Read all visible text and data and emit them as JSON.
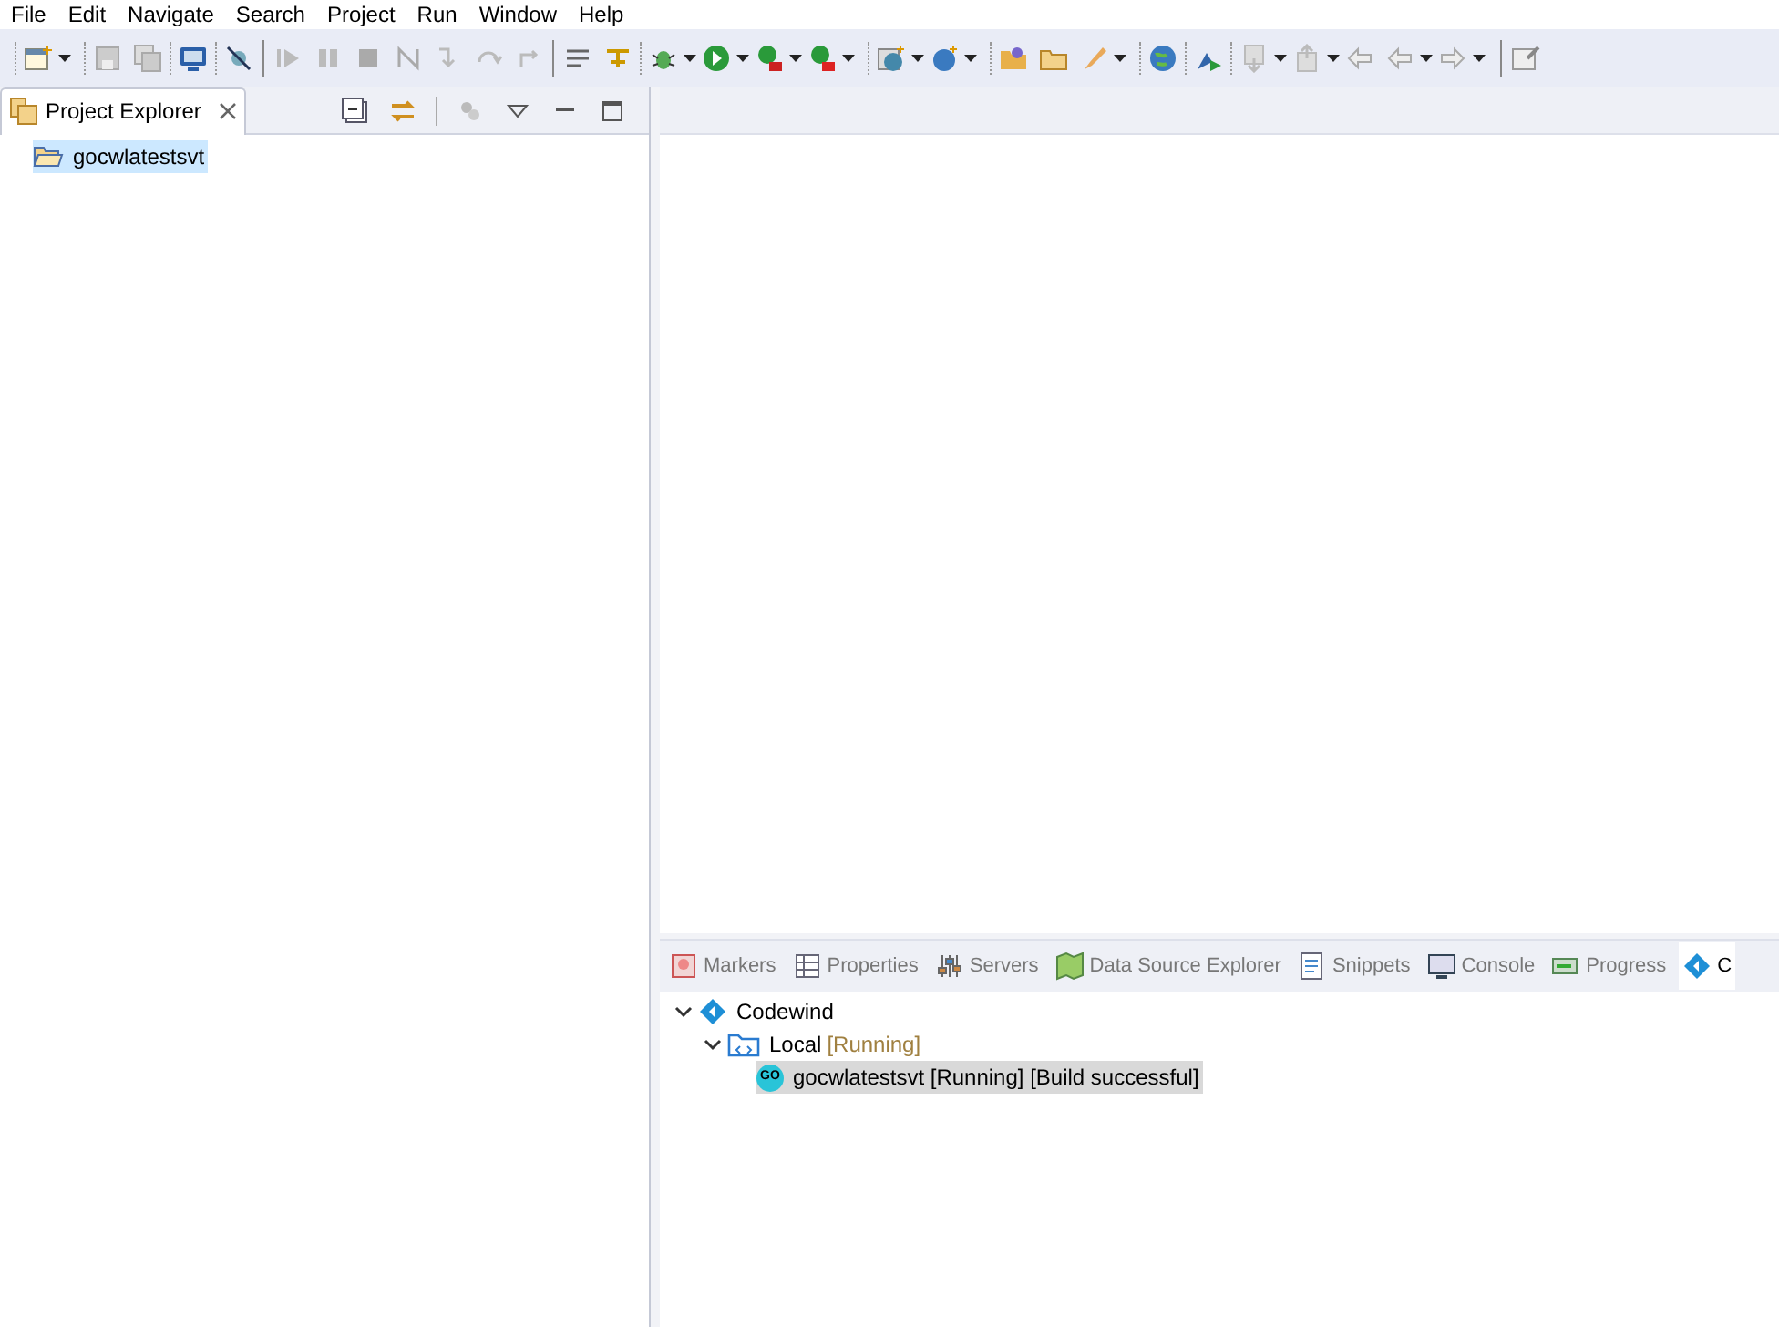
{
  "menu": [
    "File",
    "Edit",
    "Navigate",
    "Search",
    "Project",
    "Run",
    "Window",
    "Help"
  ],
  "project_explorer": {
    "tab": {
      "label": "Project Explorer",
      "selected": true
    },
    "items": [
      {
        "label": "gocwlatestsvt",
        "selected": true
      }
    ]
  },
  "bottom_panel": {
    "tabs": [
      {
        "label": "Markers",
        "selected": false
      },
      {
        "label": "Properties",
        "selected": false
      },
      {
        "label": "Servers",
        "selected": false
      },
      {
        "label": "Data Source Explorer",
        "selected": false
      },
      {
        "label": "Snippets",
        "selected": false
      },
      {
        "label": "Console",
        "selected": false
      },
      {
        "label": "Progress",
        "selected": false
      },
      {
        "label": "C",
        "selected": true
      }
    ],
    "tree": [
      {
        "label": "Codewind",
        "kind": "root",
        "expanded": true,
        "selected": false,
        "children": [
          {
            "label": "Local",
            "status": "[Running]",
            "kind": "connection",
            "expanded": true,
            "selected": false,
            "children": [
              {
                "label": "gocwlatestsvt [Running] [Build successful]",
                "kind": "project",
                "badge": "GO",
                "selected": true
              }
            ]
          }
        ]
      }
    ]
  }
}
